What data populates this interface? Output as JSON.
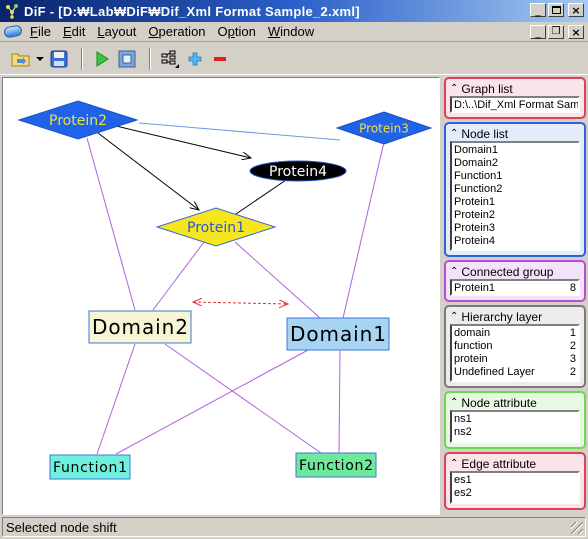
{
  "window": {
    "title": "DiF - [D:\\Lab\\DiF\\Dif_Xml Format Sample_2.xml]",
    "title_display": "DiF - [D:₩Lab₩DiF₩Dif_Xml Format Sample_2.xml]",
    "controls": [
      "minimize",
      "maximize",
      "close"
    ],
    "mdi_controls": [
      "minimize",
      "restore",
      "close"
    ]
  },
  "menu": [
    {
      "label": "File",
      "mnemonic": "F"
    },
    {
      "label": "Edit",
      "mnemonic": "E"
    },
    {
      "label": "Layout",
      "mnemonic": "L"
    },
    {
      "label": "Operation",
      "mnemonic": "O"
    },
    {
      "label": "Option",
      "mnemonic": "p"
    },
    {
      "label": "Window",
      "mnemonic": "W"
    }
  ],
  "toolbar": {
    "buttons": [
      "open-folder-icon",
      "dropdown-arrow-icon",
      "save-icon",
      "play-icon",
      "stop-icon",
      "hierarchy-layout-icon",
      "add-icon",
      "remove-icon"
    ]
  },
  "graph": {
    "nodes": [
      {
        "id": "Protein2",
        "label": "Protein2",
        "shape": "diamond",
        "fill": "#2062e8",
        "text_color": "#f0e040"
      },
      {
        "id": "Protein3",
        "label": "Protein3",
        "shape": "diamond",
        "fill": "#2062e8",
        "text_color": "#f0e040"
      },
      {
        "id": "Protein4",
        "label": "Protein4",
        "shape": "ellipse",
        "fill": "#000000",
        "text_color": "#ffffff"
      },
      {
        "id": "Protein1",
        "label": "Protein1",
        "shape": "diamond",
        "fill": "#f5e61e",
        "text_color": "#2a58d0"
      },
      {
        "id": "Domain2",
        "label": "Domain2",
        "shape": "rect",
        "fill": "#f8f5d4",
        "text_color": "#000000"
      },
      {
        "id": "Domain1",
        "label": "Domain1",
        "shape": "rect",
        "fill": "#a6d4f2",
        "text_color": "#000000"
      },
      {
        "id": "Function1",
        "label": "Function1",
        "shape": "rect",
        "fill": "#6ef0dc",
        "text_color": "#000000"
      },
      {
        "id": "Function2",
        "label": "Function2",
        "shape": "rect",
        "fill": "#6ee89a",
        "text_color": "#000000"
      }
    ],
    "edges": [
      {
        "from": "Protein2",
        "to": "Protein3",
        "style": "solid",
        "color": "#6a9ae8"
      },
      {
        "from": "Protein2",
        "to": "Protein4",
        "style": "arrow",
        "color": "#000000"
      },
      {
        "from": "Protein2",
        "to": "Protein1",
        "style": "arrow",
        "color": "#000000"
      },
      {
        "from": "Protein4",
        "to": "Protein1",
        "style": "solid",
        "color": "#000000"
      },
      {
        "from": "Protein2",
        "to": "Domain2",
        "style": "solid",
        "color": "#b060e0"
      },
      {
        "from": "Protein1",
        "to": "Domain2",
        "style": "solid",
        "color": "#b060e0"
      },
      {
        "from": "Protein1",
        "to": "Domain1",
        "style": "solid",
        "color": "#b060e0"
      },
      {
        "from": "Protein3",
        "to": "Domain1",
        "style": "solid",
        "color": "#b060e0"
      },
      {
        "from": "Domain2",
        "to": "Domain1",
        "style": "dashed-double-arrow",
        "color": "#e83030"
      },
      {
        "from": "Domain2",
        "to": "Function1",
        "style": "solid",
        "color": "#b060e0"
      },
      {
        "from": "Domain2",
        "to": "Function2",
        "style": "solid",
        "color": "#b060e0"
      },
      {
        "from": "Domain1",
        "to": "Function1",
        "style": "solid",
        "color": "#b060e0"
      },
      {
        "from": "Domain1",
        "to": "Function2",
        "style": "solid",
        "color": "#b060e0"
      }
    ]
  },
  "panels": {
    "graph_list": {
      "title": "Graph list",
      "items": [
        "D:\\..\\Dif_Xml Format Sam"
      ]
    },
    "node_list": {
      "title": "Node list",
      "items": [
        "Domain1",
        "Domain2",
        "Function1",
        "Function2",
        "Protein1",
        "Protein2",
        "Protein3",
        "Protein4"
      ]
    },
    "connected_group": {
      "title": "Connected group",
      "items": [
        {
          "name": "Protein1",
          "count": "8"
        }
      ]
    },
    "hierarchy_layer": {
      "title": "Hierarchy layer",
      "items": [
        {
          "name": "domain",
          "count": "1"
        },
        {
          "name": "function",
          "count": "2"
        },
        {
          "name": "protein",
          "count": "3"
        },
        {
          "name": "Undefined Layer",
          "count": "2"
        }
      ]
    },
    "node_attribute": {
      "title": "Node attribute",
      "items": [
        "ns1",
        "ns2"
      ]
    },
    "edge_attribute": {
      "title": "Edge attribute",
      "items": [
        "es1",
        "es2"
      ]
    }
  },
  "status": {
    "text": "Selected node shift"
  }
}
